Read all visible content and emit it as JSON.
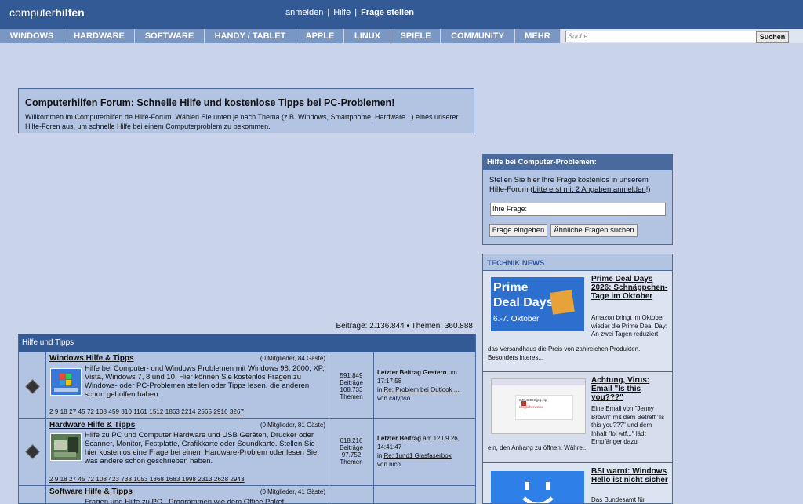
{
  "header": {
    "logo_light": "computer",
    "logo_bold": "hilfen",
    "links": [
      "anmelden",
      "Hilfe",
      "Frage stellen"
    ]
  },
  "nav": {
    "items": [
      "WINDOWS",
      "HARDWARE",
      "SOFTWARE",
      "HANDY / TABLET",
      "APPLE",
      "LINUX",
      "SPIELE",
      "COMMUNITY",
      "MEHR"
    ],
    "search_placeholder": "Suche",
    "search_button": "Suchen"
  },
  "welcome": {
    "title": "Computerhilfen Forum: Schnelle Hilfe und kostenlose Tipps bei PC-Problemen!",
    "text": "Willkommen im Computerhilfen.de Hilfe-Forum. Wählen Sie unten je nach Thema (z.B. Windows, Smartphome, Hardware...) eines unserer Hilfe-Foren aus, um schnelle Hilfe bei einem Computerproblem zu bekommen."
  },
  "stats": {
    "text": "Beiträge: 2.136.844  •  Themen: 360.888"
  },
  "forum": {
    "heading": "Hilfe und Tipps",
    "rows": [
      {
        "title": "Windows Hilfe & Tipps",
        "users": "(0 Mitglieder, 84 Gäste)",
        "desc": "Hilfe bei Computer- und Windows Problemen mit Windows 98, 2000, XP, Vista, Windows 7, 8 und 10. Hier können Sie kostenlos Fragen zu Windows- oder PC-Problemen stellen oder Tipps lesen, die anderen schon geholfen haben.",
        "pages": "2 9 18 27 45 72 108 459 810 1161 1512 1863 2214 2565 2916 3267",
        "posts": "591.849",
        "posts_label": "Beiträge",
        "threads": "108.733",
        "threads_label": "Themen",
        "last_label": "Letzter Beitrag Gestern",
        "last_time": "um 17:17:58",
        "last_in": "in",
        "last_topic": "Re: Problem bei Outlook ...",
        "last_by": "von calypso"
      },
      {
        "title": "Hardware Hilfe & Tipps",
        "users": "(0 Mitglieder, 81 Gäste)",
        "desc": "Hilfe zu PC und Computer Hardware und USB Geräten, Drucker oder Scanner, Monitor, Festplatte, Grafikkarte oder Soundkarte. Stellen Sie hier kostenlos eine Frage bei einem Hardware-Problem oder lesen Sie, was andere schon geschrieben haben.",
        "pages": "2 9 18 27 45 72 108 423 738 1053 1368 1683 1998 2313 2628 2943",
        "posts": "618.216",
        "posts_label": "Beiträge",
        "threads": "97.752",
        "threads_label": "Themen",
        "last_label": "Letzter Beitrag",
        "last_time": "am 12.09.26, 14:41:47",
        "last_in": "in",
        "last_topic": "Re: 1und1 Glasfaserbox",
        "last_by": "von nico"
      },
      {
        "title": "Software Hilfe & Tipps",
        "users": "(0 Mitglieder, 41 Gäste)",
        "desc": "Fragen und Hilfe zu PC - Programmen wie dem Office Paket"
      }
    ]
  },
  "ask": {
    "heading": "Hilfe bei Computer-Problemen:",
    "text": "Stellen Sie hier Ihre Frage kostenlos in unserem Hilfe-Forum (",
    "link": "bitte erst mit 2 Angaben anmelden",
    "text_end": "!)",
    "input_value": "Ihre Frage:",
    "btn_submit": "Frage eingeben",
    "btn_similar": "Ähnliche Fragen suchen"
  },
  "news": {
    "heading": "TECHNIK NEWS",
    "items": [
      {
        "title": "Prime Deal Days 2026: Schnäppchen-Tage im Oktober",
        "text_right": "Amazon bringt im Oktober wieder die Prime Deal Day: An zwei Tagen reduziert",
        "text_full": "das Versandhaus die Preis von zahlreichen Produkten. Besonders interes...",
        "img_line1": "Prime",
        "img_line2": "Deal Days",
        "img_line3": "6.-7. Oktober"
      },
      {
        "title": "Achtung, Virus: Email \"Is this you???\"",
        "text_right": "Eine Email von \"Jenny Brown\" mit dem Betreff \"Is this you???\" und dem Inhalt \"lol wtf...\" lädt Empfänger dazu",
        "text_full": "ein, den Anhang zu öffnen. Währe...",
        "img_file": "IMG40003.jpg.zip",
        "img_warn": "Möglicherweise"
      },
      {
        "title": "BSI warnt: Windows Hello ist nicht sicher",
        "text_right": "Das Bundesamt für"
      }
    ]
  },
  "colors": {
    "header": "#335a95",
    "nav": "#7a96c3",
    "page_bg": "#c9d4ea",
    "panel": "#b3c3e2"
  }
}
